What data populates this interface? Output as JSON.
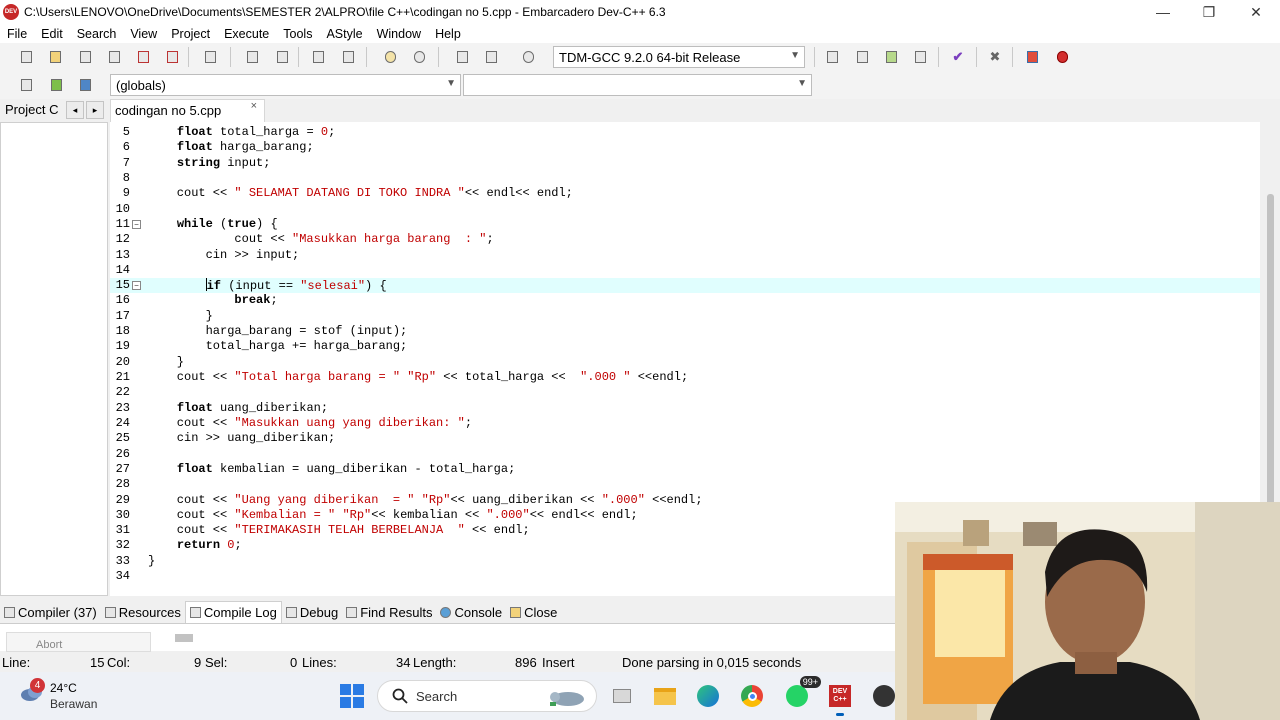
{
  "window": {
    "title": "C:\\Users\\LENOVO\\OneDrive\\Documents\\SEMESTER 2\\ALPRO\\file C++\\codingan no 5.cpp - Embarcadero Dev-C++ 6.3",
    "icon_label": "DEV",
    "minimize": "—",
    "maximize": "❐",
    "close": "✕"
  },
  "menu": [
    {
      "label": "File"
    },
    {
      "label": "Edit"
    },
    {
      "label": "Search"
    },
    {
      "label": "View"
    },
    {
      "label": "Project"
    },
    {
      "label": "Execute"
    },
    {
      "label": "Tools"
    },
    {
      "label": "AStyle"
    },
    {
      "label": "Window"
    },
    {
      "label": "Help"
    }
  ],
  "toolbar": {
    "compiler": "TDM-GCC 9.2.0 64-bit Release",
    "globals": "(globals)",
    "members": ""
  },
  "tabs": {
    "project_tab": "Project  C",
    "prev": "◂",
    "next": "▸",
    "file_tab": "codingan no 5.cpp",
    "file_tab_close": "×"
  },
  "editor": {
    "current_line": 15,
    "lines": [
      {
        "n": "5",
        "code": "    float total_harga = 0;"
      },
      {
        "n": "6",
        "code": "    float harga_barang;"
      },
      {
        "n": "7",
        "code": "    string input;"
      },
      {
        "n": "8",
        "code": ""
      },
      {
        "n": "9",
        "code": "    cout << \" SELAMAT DATANG DI TOKO INDRA \"<< endl<< endl;"
      },
      {
        "n": "10",
        "code": ""
      },
      {
        "n": "11",
        "code": "    while (true) {"
      },
      {
        "n": "12",
        "code": "            cout << \"Masukkan harga barang  : \";"
      },
      {
        "n": "13",
        "code": "        cin >> input;"
      },
      {
        "n": "14",
        "code": ""
      },
      {
        "n": "15",
        "code": "        if (input == \"selesai\") {"
      },
      {
        "n": "16",
        "code": "            break;"
      },
      {
        "n": "17",
        "code": "        }"
      },
      {
        "n": "18",
        "code": "        harga_barang = stof (input);"
      },
      {
        "n": "19",
        "code": "        total_harga += harga_barang;"
      },
      {
        "n": "20",
        "code": "    }"
      },
      {
        "n": "21",
        "code": "    cout << \"Total harga barang = \" \"Rp\" << total_harga <<  \".000 \" <<endl;"
      },
      {
        "n": "22",
        "code": ""
      },
      {
        "n": "23",
        "code": "    float uang_diberikan;"
      },
      {
        "n": "24",
        "code": "    cout << \"Masukkan uang yang diberikan: \";"
      },
      {
        "n": "25",
        "code": "    cin >> uang_diberikan;"
      },
      {
        "n": "26",
        "code": ""
      },
      {
        "n": "27",
        "code": "    float kembalian = uang_diberikan - total_harga;"
      },
      {
        "n": "28",
        "code": ""
      },
      {
        "n": "29",
        "code": "    cout << \"Uang yang diberikan  = \" \"Rp\"<< uang_diberikan << \".000\" <<endl;"
      },
      {
        "n": "30",
        "code": "    cout << \"Kembalian = \" \"Rp\"<< kembalian << \".000\"<< endl<< endl;"
      },
      {
        "n": "31",
        "code": "    cout << \"TERIMAKASIH TELAH BERBELANJA  \" << endl;"
      },
      {
        "n": "32",
        "code": "    return 0;"
      },
      {
        "n": "33",
        "code": "}"
      },
      {
        "n": "34",
        "code": ""
      }
    ]
  },
  "bottom_tabs": [
    {
      "label": "Compiler (37)",
      "icon": "compiler-icon"
    },
    {
      "label": "Resources",
      "icon": "resources-icon"
    },
    {
      "label": "Compile Log",
      "icon": "compile-log-icon",
      "active": true
    },
    {
      "label": "Debug",
      "icon": "debug-icon"
    },
    {
      "label": "Find Results",
      "icon": "find-results-icon"
    },
    {
      "label": "Console",
      "icon": "console-icon"
    },
    {
      "label": "Close",
      "icon": "close-panel-icon"
    }
  ],
  "compile_log": {
    "abort_label": "Abort Compilation"
  },
  "status": {
    "line_label": "Line:",
    "line_value": "15",
    "col_label": "Col:",
    "col_value": "9",
    "sel_label": "Sel:",
    "sel_value": "0",
    "lines_label": "Lines:",
    "lines_value": "34",
    "length_label": "Length:",
    "length_value": "896",
    "mode": "Insert",
    "message": "Done parsing in 0,015 seconds"
  },
  "taskbar": {
    "weather_badge": "4",
    "temperature": "24°C",
    "condition": "Berawan",
    "search_label": "Search",
    "whatsapp_badge": "99+",
    "devcpp_label": "DEV C++"
  },
  "colors": {
    "current_line_bg": "#e0fefe",
    "string_color": "#c00000",
    "accent": "#005fb8"
  }
}
